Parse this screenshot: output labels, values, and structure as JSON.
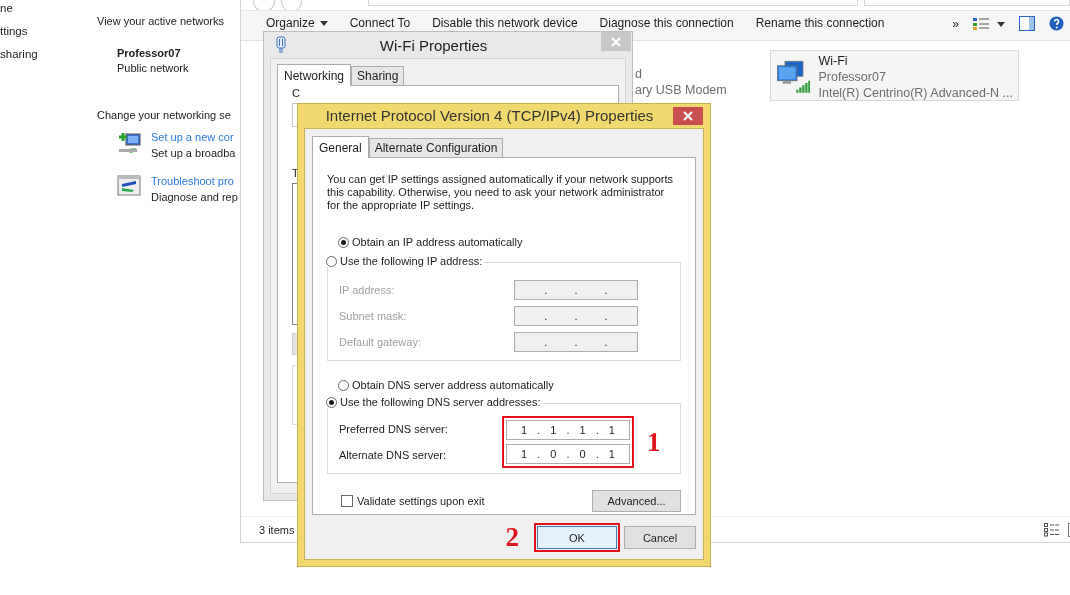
{
  "control_panel": {
    "nav_links": [
      "ne",
      "ttings",
      "sharing"
    ],
    "heading": "View your active networks",
    "network": {
      "name": "Professor07",
      "category": "Public network"
    },
    "section_heading": "Change your networking se",
    "tasks": [
      {
        "kind": "new-connection",
        "link": "Set up a new cor",
        "description": "Set up a broadba"
      },
      {
        "kind": "troubleshoot",
        "link": "Troubleshoot pro",
        "description": "Diagnose and rep"
      }
    ]
  },
  "explorer": {
    "toolbar": [
      {
        "label": "Organize",
        "dropdown": true
      },
      {
        "label": "Connect To",
        "dropdown": false
      },
      {
        "label": "Disable this network device",
        "dropdown": false
      },
      {
        "label": "Diagnose this connection",
        "dropdown": false
      },
      {
        "label": "Rename this connection",
        "dropdown": false
      }
    ],
    "overflow": "»",
    "connections": [
      {
        "kind": "partial",
        "name": "d",
        "device": "ary USB Modem"
      },
      {
        "kind": "wifi",
        "name": "Wi-Fi",
        "network": "Professor07",
        "device": "Intel(R) Centrino(R) Advanced-N ..."
      }
    ],
    "status": "3 items"
  },
  "wifi_dialog": {
    "title": "Wi-Fi Properties",
    "tabs": [
      {
        "label": "Networking",
        "selected": true
      },
      {
        "label": "Sharing",
        "selected": false
      }
    ],
    "labels": [
      "C",
      "T"
    ]
  },
  "ipv4_dialog": {
    "title": "Internet Protocol Version 4 (TCP/IPv4) Properties",
    "tabs": [
      {
        "label": "General",
        "selected": true
      },
      {
        "label": "Alternate Configuration",
        "selected": false
      }
    ],
    "description": "You can get IP settings assigned automatically if your network supports this capability. Otherwise, you need to ask your network administrator for the appropriate IP settings.",
    "ip_options": [
      {
        "label": "Obtain an IP address automatically",
        "selected": true
      },
      {
        "label": "Use the following IP address:",
        "selected": false
      }
    ],
    "ip_group": {
      "disabled": true,
      "fields": [
        {
          "label": "IP address:",
          "value": ". . ."
        },
        {
          "label": "Subnet mask:",
          "value": ". . ."
        },
        {
          "label": "Default gateway:",
          "value": ". . ."
        }
      ]
    },
    "dns_options": [
      {
        "label": "Obtain DNS server address automatically",
        "selected": false
      },
      {
        "label": "Use the following DNS server addresses:",
        "selected": true
      }
    ],
    "dns_group": {
      "disabled": false,
      "callout": "1",
      "fields": [
        {
          "label": "Preferred DNS server:",
          "value": "1 . 1 . 1 . 1"
        },
        {
          "label": "Alternate DNS server:",
          "value": "1 . 0 . 0 . 1"
        }
      ]
    },
    "validate": {
      "label": "Validate settings upon exit",
      "checked": false
    },
    "advanced_button": "Advanced...",
    "buttons": [
      {
        "label": "OK",
        "default": true,
        "callout": "2"
      },
      {
        "label": "Cancel",
        "default": false
      }
    ]
  }
}
